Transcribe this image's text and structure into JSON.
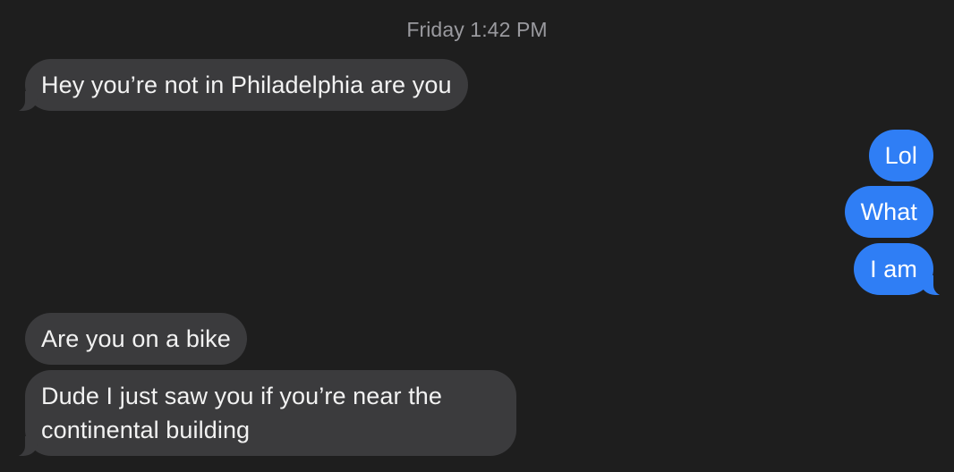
{
  "conversation": {
    "timestamp": "Friday 1:42 PM",
    "messages": [
      {
        "direction": "incoming",
        "text": "Hey you’re not in Philadelphia are you"
      },
      {
        "direction": "outgoing",
        "text": "Lol"
      },
      {
        "direction": "outgoing",
        "text": "What"
      },
      {
        "direction": "outgoing",
        "text": "I am"
      },
      {
        "direction": "incoming",
        "text": "Are you on a bike"
      },
      {
        "direction": "incoming",
        "text": "Dude I just saw you if you’re near the continental building"
      }
    ]
  },
  "colors": {
    "background": "#1e1e1e",
    "incoming_bubble": "#3b3b3d",
    "outgoing_bubble": "#2f7ef5",
    "timestamp_text": "#9a9a9f"
  }
}
